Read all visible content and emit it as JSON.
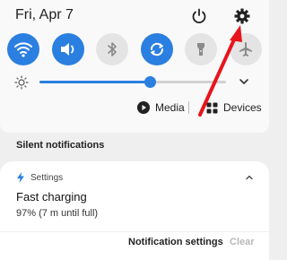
{
  "header": {
    "date": "Fri, Apr 7",
    "power_icon": "power-icon",
    "settings_icon": "gear-icon"
  },
  "quick_settings": {
    "tiles": [
      {
        "icon": "wifi-icon",
        "state": "on"
      },
      {
        "icon": "sound-icon",
        "state": "on"
      },
      {
        "icon": "bluetooth-icon",
        "state": "off"
      },
      {
        "icon": "auto-rotate-icon",
        "state": "on"
      },
      {
        "icon": "flashlight-icon",
        "state": "off"
      },
      {
        "icon": "airplane-mode-icon",
        "state": "off"
      }
    ],
    "brightness_level": 0.59
  },
  "media_bar": {
    "media_label": "Media",
    "devices_label": "Devices"
  },
  "notifications": {
    "section_header": "Silent notifications",
    "card": {
      "app_name": "Settings",
      "title": "Fast charging",
      "text": "97% (7 m until full)"
    },
    "settings_label": "Notification settings",
    "clear_label": "Clear"
  },
  "colors": {
    "accent": "#2b7fe0",
    "annotation": "#e8141c"
  }
}
